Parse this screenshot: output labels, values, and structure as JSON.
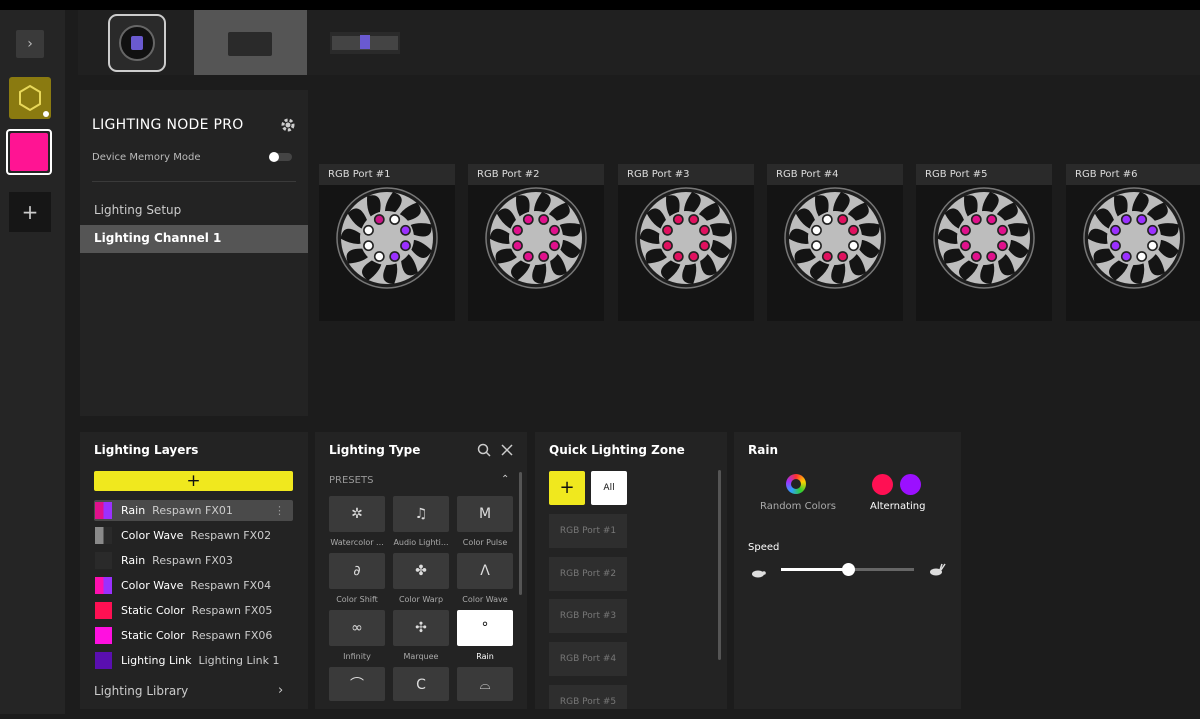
{
  "rail": {
    "expand_icon": "chevron-right-icon",
    "add_icon": "plus-icon",
    "selected_color": "#ff1493",
    "profile_color": "#8a7a10"
  },
  "devices": [
    {
      "name": "cooler-thumbnail"
    },
    {
      "name": "node-thumbnail"
    },
    {
      "name": "ram-thumbnail"
    }
  ],
  "device_panel": {
    "title": "LIGHTING NODE PRO",
    "memory_mode_label": "Device Memory Mode",
    "nav": [
      "Lighting Setup",
      "Lighting Channel 1"
    ]
  },
  "ports": [
    {
      "label": "RGB Port #1",
      "leds": [
        "#ffffff",
        "#9b30ff",
        "#9b30ff",
        "#9b30ff",
        "#ffffff",
        "#ffffff",
        "#ffffff",
        "#c71585"
      ]
    },
    {
      "label": "RGB Port #2",
      "leds": [
        "#e0118c",
        "#e0118c",
        "#e0118c",
        "#e0118c",
        "#e0118c",
        "#e0118c",
        "#e0118c",
        "#e0118c"
      ]
    },
    {
      "label": "RGB Port #3",
      "leds": [
        "#e0115f",
        "#e0115f",
        "#e0115f",
        "#e0115f",
        "#e0115f",
        "#e0115f",
        "#e0115f",
        "#e0115f"
      ]
    },
    {
      "label": "RGB Port #4",
      "leds": [
        "#e0115f",
        "#e0115f",
        "#ffffff",
        "#e0115f",
        "#e0115f",
        "#ffffff",
        "#ffffff",
        "#ffffff"
      ]
    },
    {
      "label": "RGB Port #5",
      "leds": [
        "#e0118c",
        "#e0118c",
        "#e0118c",
        "#e0118c",
        "#e0118c",
        "#e0118c",
        "#e0118c",
        "#e0118c"
      ]
    },
    {
      "label": "RGB Port #6",
      "leds": [
        "#9b30ff",
        "#9b30ff",
        "#ffffff",
        "#ffffff",
        "#9b30ff",
        "#9b30ff",
        "#9b30ff",
        "#9b30ff"
      ]
    }
  ],
  "layers": {
    "title": "Lighting Layers",
    "add_label": "+",
    "items": [
      {
        "effect": "Rain",
        "name": "Respawn FX01",
        "color": "#e0118c",
        "color2": "#9b30ff"
      },
      {
        "effect": "Color Wave",
        "name": "Respawn FX02",
        "color": "#8a8a8a",
        "color2": "#2a2a2a"
      },
      {
        "effect": "Rain",
        "name": "Respawn FX03",
        "color": "#2a2a2a",
        "color2": "#2a2a2a"
      },
      {
        "effect": "Color Wave",
        "name": "Respawn FX04",
        "color": "#ff10b0",
        "color2": "#9b30ff"
      },
      {
        "effect": "Static Color",
        "name": "Respawn FX05",
        "color": "#ff1053",
        "color2": "#ff1053"
      },
      {
        "effect": "Static Color",
        "name": "Respawn FX06",
        "color": "#ff10e0",
        "color2": "#ff10e0"
      },
      {
        "effect": "Lighting Link",
        "name": "Lighting Link 1",
        "color": "#5a0fb0",
        "color2": "#5a0fb0"
      }
    ],
    "library_label": "Lighting Library"
  },
  "lighting_type": {
    "title": "Lighting Type",
    "section": "PRESETS",
    "tiles": [
      {
        "label": "Watercolor ...",
        "icon": "watercolor-icon"
      },
      {
        "label": "Audio Lighti...",
        "icon": "music-note-icon"
      },
      {
        "label": "Color Pulse",
        "icon": "pulse-icon"
      },
      {
        "label": "Color Shift",
        "icon": "link-icon"
      },
      {
        "label": "Color Warp",
        "icon": "warp-icon"
      },
      {
        "label": "Color Wave",
        "icon": "wave-icon"
      },
      {
        "label": "Infinity",
        "icon": "infinity-icon"
      },
      {
        "label": "Marquee",
        "icon": "marquee-icon"
      },
      {
        "label": "Rain",
        "icon": "rain-icon"
      },
      {
        "label": "",
        "icon": "arc-icon"
      },
      {
        "label": "",
        "icon": "spiral-icon"
      },
      {
        "label": "",
        "icon": "dome-icon"
      }
    ]
  },
  "quick_zone": {
    "title": "Quick Lighting Zone",
    "all_label": "All",
    "zones": [
      "RGB Port #1",
      "RGB Port #2",
      "RGB Port #3",
      "RGB Port #4",
      "RGB Port #5"
    ]
  },
  "rain": {
    "title": "Rain",
    "random_label": "Random Colors",
    "alternating_label": "Alternating",
    "color_a": "#ff1053",
    "color_b": "#9b10ff",
    "speed_label": "Speed",
    "speed_value": 0.5
  }
}
